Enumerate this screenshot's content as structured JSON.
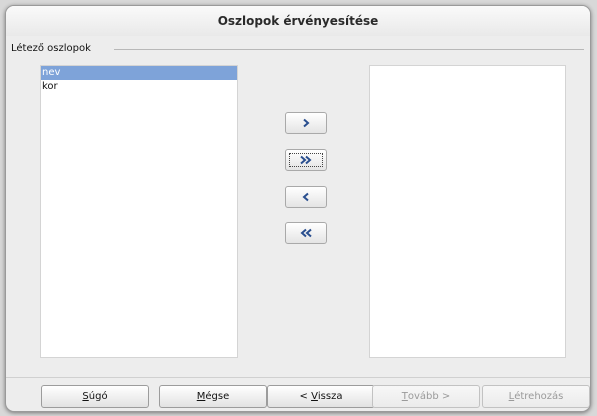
{
  "dialog": {
    "title": "Oszlopok érvényesítése"
  },
  "group": {
    "label": "Létező oszlopok"
  },
  "left_list": {
    "items": [
      {
        "label": "nev",
        "selected": true
      },
      {
        "label": "kor",
        "selected": false
      }
    ]
  },
  "right_list": {
    "items": []
  },
  "move_buttons": {
    "add_one": {
      "icon": "chevron-right-icon"
    },
    "add_all": {
      "icon": "double-chevron-right-icon"
    },
    "remove_one": {
      "icon": "chevron-left-icon"
    },
    "remove_all": {
      "icon": "double-chevron-left-icon"
    }
  },
  "buttons": {
    "help": {
      "mnemonic": "S",
      "rest": "úgó"
    },
    "cancel": {
      "mnemonic": "M",
      "rest": "égse"
    },
    "back": {
      "prefix": "< ",
      "mnemonic": "V",
      "rest": "issza"
    },
    "next": {
      "mnemonic": "T",
      "rest": "ovább >",
      "enabled": false
    },
    "create": {
      "mnemonic": "L",
      "rest": "étrehozás",
      "enabled": false
    }
  },
  "colors": {
    "selection": "#7ea3d9",
    "arrow": "#2a4f8f"
  }
}
